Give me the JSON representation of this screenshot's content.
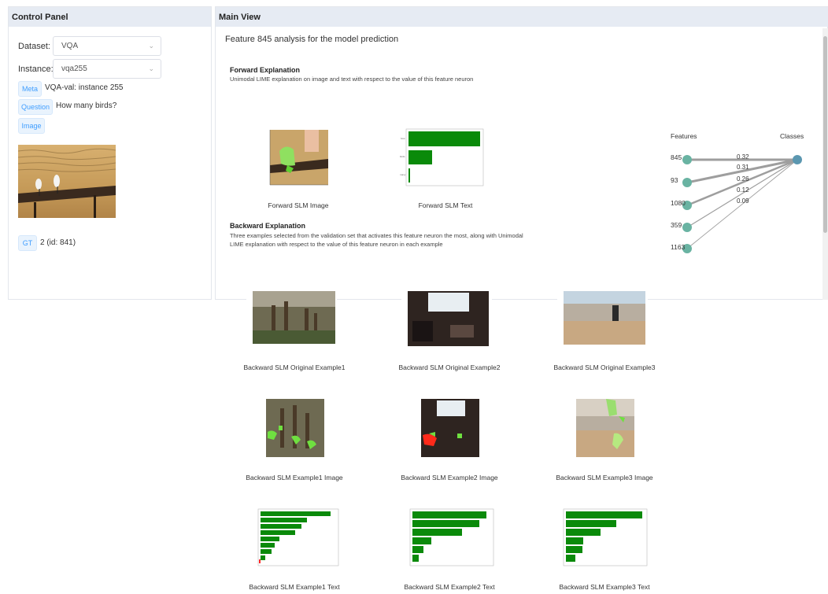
{
  "control_panel": {
    "title": "Control Panel",
    "dataset_label": "Dataset:",
    "dataset_value": "VQA",
    "instance_label": "Instance:",
    "instance_value": "vqa255",
    "meta_tag": "Meta",
    "meta_text": "VQA-val: instance 255",
    "question_tag": "Question",
    "question_text": "How many birds?",
    "image_tag": "Image",
    "gt_tag": "GT",
    "gt_text": "2 (id: 841)"
  },
  "main_view": {
    "title": "Main View",
    "heading": "Feature 845 analysis for the model prediction",
    "forward": {
      "title": "Forward Explanation",
      "desc": "Unimodal LIME explanation on image and text with respect to the value of this feature neuron",
      "captions": [
        "Forward SLM Image",
        "Forward SLM Text"
      ]
    },
    "backward": {
      "title": "Backward Explanation",
      "desc_line1": "Three examples selected from the validation set that activates this feature neuron the most, along with Unimodal",
      "desc_line2": "LIME explanation with respect to the value of this feature neuron in each example",
      "original_captions": [
        "Backward SLM Original Example1",
        "Backward SLM Original Example2",
        "Backward SLM Original Example3"
      ],
      "image_captions": [
        "Backward SLM Example1 Image",
        "Backward SLM Example2 Image",
        "Backward SLM Example3 Image"
      ],
      "text_captions": [
        "Backward SLM Example1 Text",
        "Backward SLM Example2 Text",
        "Backward SLM Example3 Text"
      ]
    },
    "graph": {
      "features_label": "Features",
      "classes_label": "Classes",
      "features": [
        "845",
        "93",
        "1080",
        "359",
        "1163"
      ],
      "weights": [
        "0.32",
        "0.31",
        "0.26",
        "0.12",
        "0.09"
      ],
      "node_color": "#69b3a2",
      "class_color": "#5b97b0"
    }
  }
}
